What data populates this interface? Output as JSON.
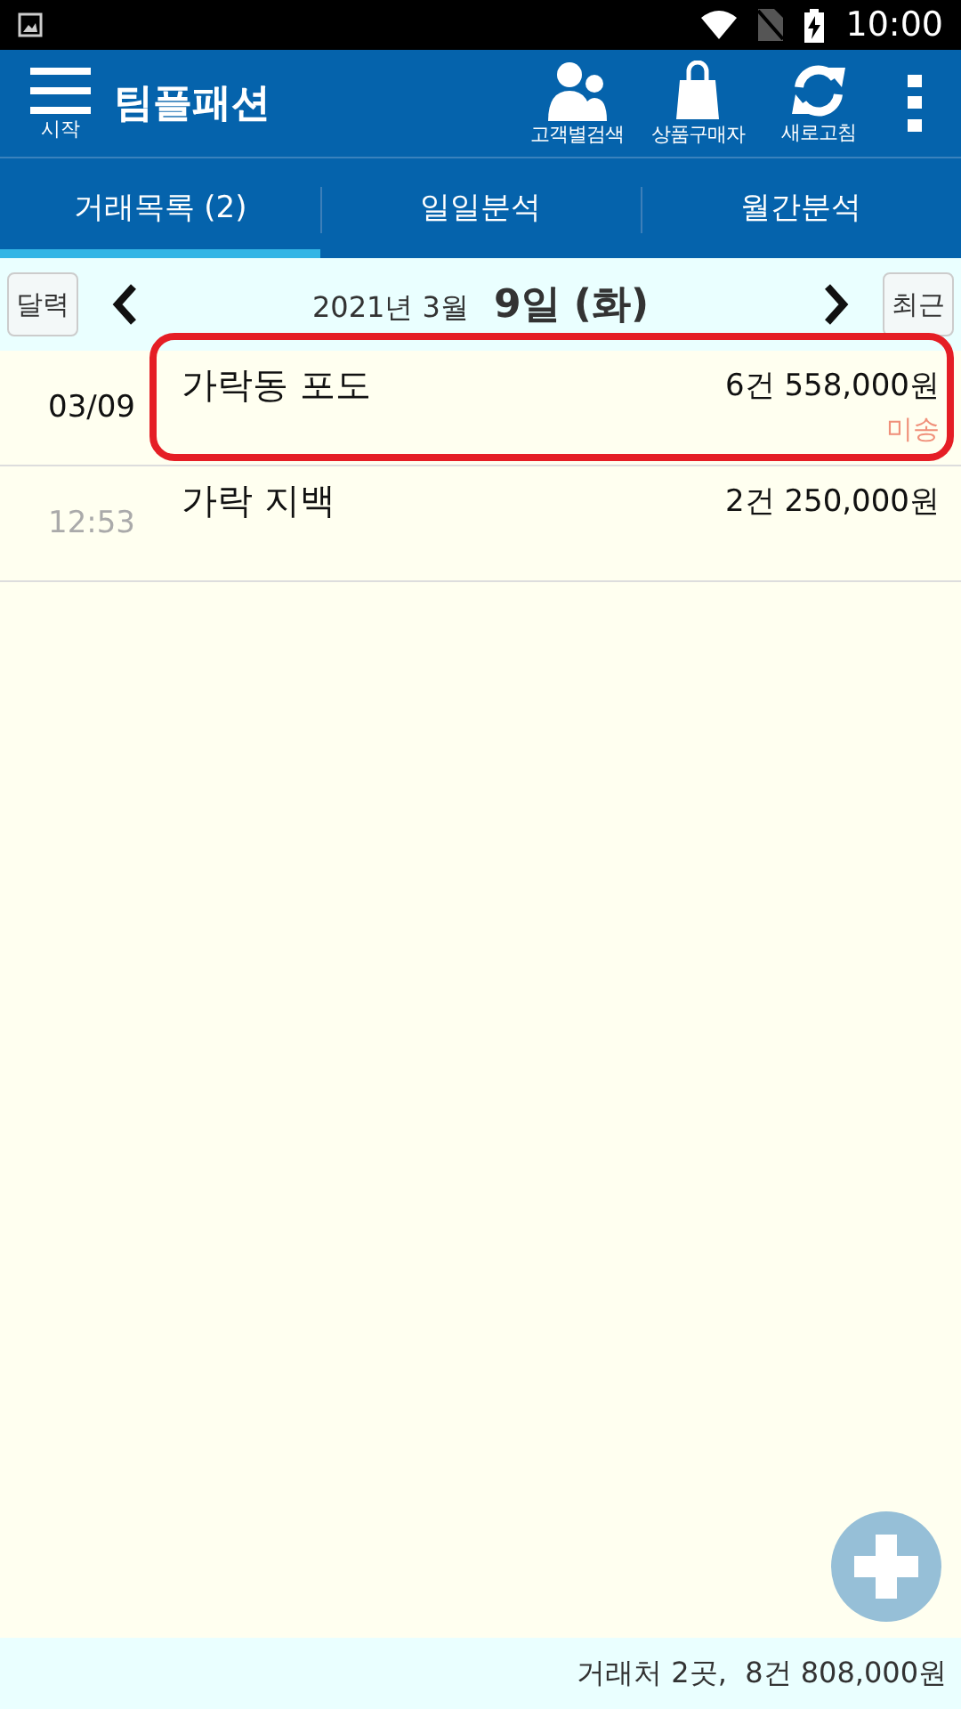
{
  "status_bar": {
    "time": "10:00"
  },
  "header": {
    "menu_label": "시작",
    "title": "팀플패션",
    "actions": [
      {
        "kind": "people",
        "label": "고객별검색"
      },
      {
        "kind": "bag",
        "label": "상품구매자"
      },
      {
        "kind": "refresh",
        "label": "새로고침"
      }
    ]
  },
  "tabs": [
    {
      "label": "거래목록 (2)",
      "selected": true
    },
    {
      "label": "일일분석",
      "selected": false
    },
    {
      "label": "월간분석",
      "selected": false
    }
  ],
  "date_bar": {
    "left_button": "달력",
    "year_month": "2021년 3월",
    "day": "9일 (화)",
    "right_button": "최근"
  },
  "rows": [
    {
      "kind": "date",
      "stamp": "03/09",
      "name": "가락동 포도",
      "amount": "6건 558,000원",
      "status": "미송",
      "highlighted": true
    },
    {
      "kind": "time",
      "stamp": "12:53",
      "name": "가락 지백",
      "amount": "2건 250,000원",
      "highlighted": false
    }
  ],
  "footer": {
    "summary": "거래처 2곳,  8건 808,000원"
  }
}
